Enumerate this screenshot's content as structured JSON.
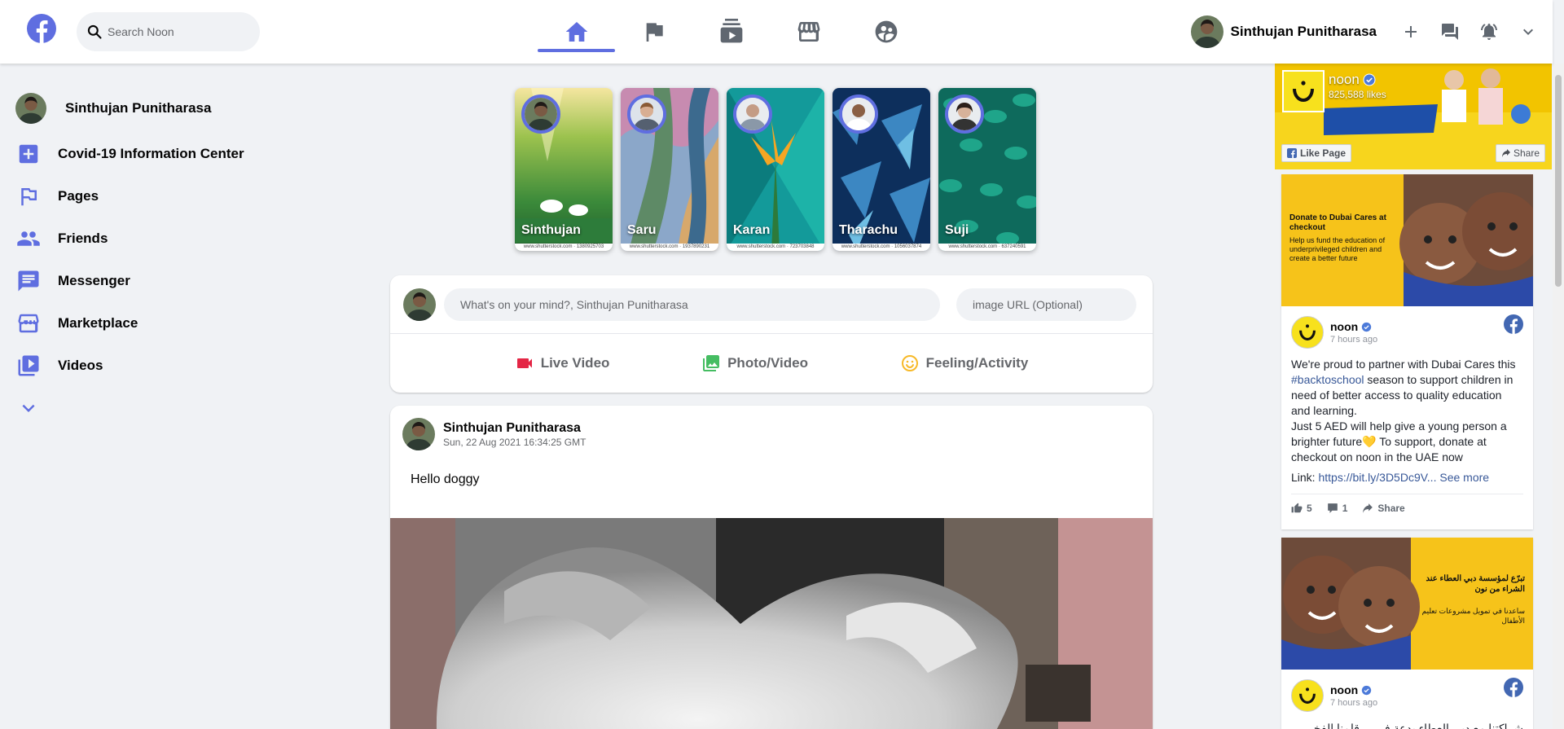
{
  "header": {
    "search_placeholder": "Search Noon",
    "user_name": "Sinthujan Punitharasa"
  },
  "sidebar": {
    "profile_name": "Sinthujan Punitharasa",
    "items": [
      {
        "label": "Covid-19 Information Center",
        "icon": "plus-square-icon"
      },
      {
        "label": "Pages",
        "icon": "flag-icon"
      },
      {
        "label": "Friends",
        "icon": "people-icon"
      },
      {
        "label": "Messenger",
        "icon": "chat-icon"
      },
      {
        "label": "Marketplace",
        "icon": "storefront-icon"
      },
      {
        "label": "Videos",
        "icon": "video-library-icon"
      }
    ]
  },
  "stories": [
    {
      "name": "Sinthujan",
      "footer": "www.shutterstock.com · 1380925703"
    },
    {
      "name": "Saru",
      "footer": "www.shutterstock.com · 1937890231"
    },
    {
      "name": "Karan",
      "footer": "www.shutterstock.com · 723703848"
    },
    {
      "name": "Tharachu",
      "footer": "www.shutterstock.com · 1056037874"
    },
    {
      "name": "Suji",
      "footer": "www.shutterstock.com · 637240591"
    }
  ],
  "composer": {
    "placeholder": "What's on your mind?, Sinthujan Punitharasa",
    "url_placeholder": "image URL (Optional)",
    "live_label": "Live Video",
    "photo_label": "Photo/Video",
    "feeling_label": "Feeling/Activity"
  },
  "post": {
    "author": "Sinthujan Punitharasa",
    "timestamp": "Sun, 22 Aug 2021 16:34:25 GMT",
    "text": "Hello doggy"
  },
  "ad_page": {
    "name": "noon",
    "likes": "825,588 likes",
    "like_button": "Like Page",
    "share_button": "Share"
  },
  "ad_post_1": {
    "banner_title": "Donate to Dubai Cares at checkout",
    "banner_sub": "Help us fund the education of underprivileged children and create a better future",
    "name": "noon",
    "time": "7 hours ago",
    "body_start": "We're proud to partner with Dubai Cares this ",
    "hashtag": "#backtoschool",
    "body_rest": " season to support children in need of better access to quality education and learning.",
    "body_2": "Just 5 AED will help give a young person a brighter future💛 To support, donate at checkout on noon in the UAE now",
    "link_prefix": "Link: ",
    "link": "https://bit.ly/3D5Dc9V...",
    "see_more": "See more",
    "likes": "5",
    "comments": "1",
    "share": "Share"
  },
  "ad_post_2": {
    "banner_title": "تبرّع لمؤسسة دبي العطاء عند الشراء من نون",
    "banner_sub": "ساعدنا في تمويل مشروعات تعليم الأطفال",
    "name": "noon",
    "time": "7 hours ago",
    "body_start": "شراكتنا مع دبي العطاء بدعة في ... قلمنا الفخر"
  }
}
